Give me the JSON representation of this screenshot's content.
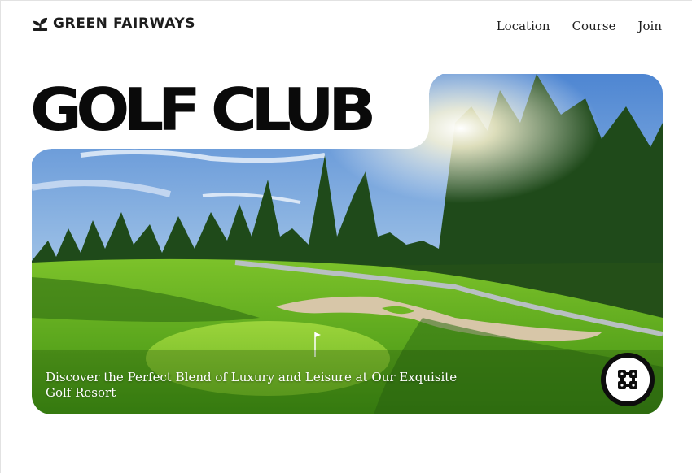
{
  "brand": {
    "name": "GREEN FAIRWAYS",
    "logo_icon": "sprout-icon"
  },
  "nav": {
    "items": [
      "Location",
      "Course",
      "Join"
    ]
  },
  "hero": {
    "headline": "GOLF CLUB",
    "tagline": "Discover the Perfect Blend of Luxury and Leisure at Our Exquisite Golf Resort",
    "badge_icon": "grid-pattern-icon"
  },
  "colors": {
    "text": "#1d1d1d",
    "headline": "#0a0a0a",
    "badge": "#0d0d0d",
    "grass": "#5aa51e"
  }
}
